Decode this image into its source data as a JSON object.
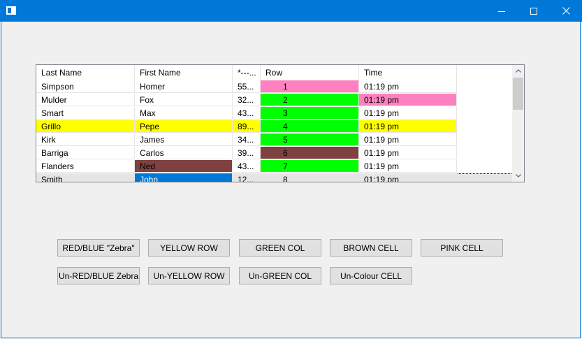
{
  "window": {
    "title": ""
  },
  "table": {
    "columns": [
      "Last Name",
      "First Name",
      "*---...",
      "Row",
      "Time"
    ],
    "rows": [
      {
        "last": "Simpson",
        "first": "Homer",
        "third": "55...",
        "row": "1",
        "time": "01:19 pm"
      },
      {
        "last": "Mulder",
        "first": "Fox",
        "third": "32...",
        "row": "2",
        "time": "01:19 pm"
      },
      {
        "last": "Smart",
        "first": "Max",
        "third": "43...",
        "row": "3",
        "time": "01:19 pm"
      },
      {
        "last": "Grillo",
        "first": "Pepe",
        "third": "89...",
        "row": "4",
        "time": "01:19 pm"
      },
      {
        "last": "Kirk",
        "first": "James",
        "third": "34...",
        "row": "5",
        "time": "01:19 pm"
      },
      {
        "last": "Barriga",
        "first": "Carlos",
        "third": "39...",
        "row": "6",
        "time": "01:19 pm"
      },
      {
        "last": "Flanders",
        "first": "Ned",
        "third": "43...",
        "row": "7",
        "time": "01:19 pm"
      },
      {
        "last": "Smith",
        "first": "John",
        "third": "12...",
        "row": "8",
        "time": "01:19 pm"
      }
    ]
  },
  "buttons": {
    "zebra": "RED/BLUE \"Zebra\"",
    "yellow_row": "YELLOW ROW",
    "green_col": "GREEN COL",
    "brown_cell": "BROWN CELL",
    "pink_cell": "PINK CELL",
    "unzebra": "Un-RED/BLUE Zebra",
    "unyellow_row": "Un-YELLOW ROW",
    "ungreen_col": "Un-GREEN COL",
    "uncolour_cell": "Un-Colour CELL"
  },
  "colors": {
    "titlebar": "#0078d7",
    "yellow": "#ffff00",
    "green": "#00ff00",
    "brown": "#7f4040",
    "pink": "#ff80c0",
    "selected": "#0078d7",
    "selected_row": "#e5e5e5"
  }
}
